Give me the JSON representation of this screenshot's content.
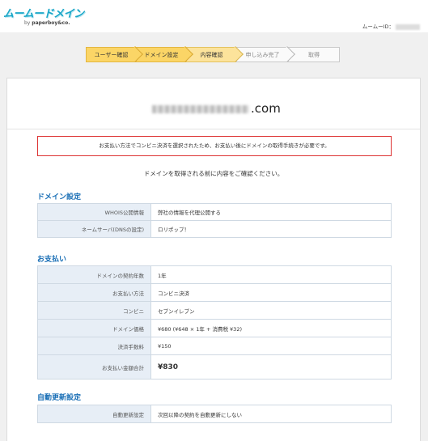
{
  "header": {
    "logo_main": "ムームードメイン",
    "logo_sub_prefix": "by ",
    "logo_sub_brand": "paperboy&co.",
    "user_id_label": "ムームーID："
  },
  "steps": [
    {
      "label": "ユーザー確認",
      "state": "done"
    },
    {
      "label": "ドメイン設定",
      "state": "done"
    },
    {
      "label": "内容確認",
      "state": "current"
    },
    {
      "label": "申し込み完了",
      "state": "todo"
    },
    {
      "label": "取得",
      "state": "todo"
    }
  ],
  "domain": {
    "suffix": ".com"
  },
  "notice": "お支払い方法でコンビニ決済を選択されたため、お支払い後にドメインの取得手続きが必要です。",
  "confirm_message": "ドメインを取得される前に内容をご確認ください。",
  "domain_settings": {
    "title": "ドメイン設定",
    "rows": [
      {
        "key": "WHOIS公開情報",
        "value": "弊社の情報を代理公開する"
      },
      {
        "key": "ネームサーバ(DNSの設定)",
        "value": "ロリポップ！"
      }
    ]
  },
  "payment": {
    "title": "お支払い",
    "rows": [
      {
        "key": "ドメインの契約年数",
        "value": "1年"
      },
      {
        "key": "お支払い方法",
        "value": "コンビニ決済"
      },
      {
        "key": "コンビニ",
        "value": "セブンイレブン"
      },
      {
        "key": "ドメイン価格",
        "value": "¥680 (¥648 × 1年 + 消費税 ¥32)"
      },
      {
        "key": "決済手数料",
        "value": "¥150"
      },
      {
        "key": "お支払い金額合計",
        "value": "¥830"
      }
    ]
  },
  "auto_renew": {
    "title": "自動更新設定",
    "rows": [
      {
        "key": "自動更新設定",
        "value": "次回以降の契約を自動更新にしない"
      }
    ]
  },
  "colors": {
    "logo": "#19a7c8",
    "step_done": "#fbd566",
    "step_current": "#fce39b",
    "section_title": "#1a6fb6",
    "notice_border": "#dd3333",
    "table_key_bg": "#e7eef6"
  }
}
